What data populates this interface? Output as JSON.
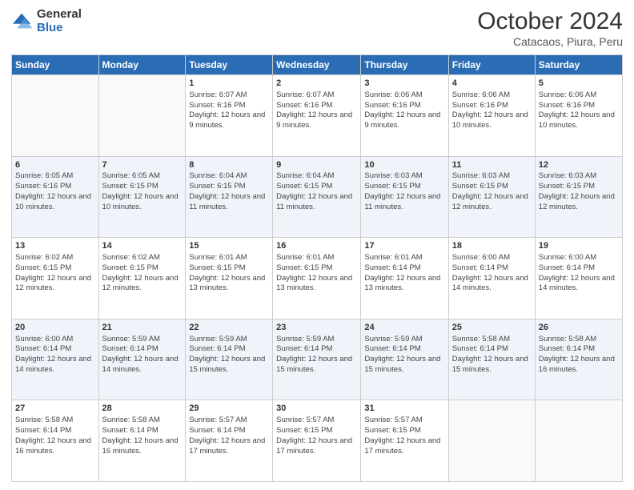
{
  "logo": {
    "general": "General",
    "blue": "Blue"
  },
  "header": {
    "month": "October 2024",
    "location": "Catacaos, Piura, Peru"
  },
  "weekdays": [
    "Sunday",
    "Monday",
    "Tuesday",
    "Wednesday",
    "Thursday",
    "Friday",
    "Saturday"
  ],
  "weeks": [
    [
      {
        "day": "",
        "empty": true
      },
      {
        "day": "",
        "empty": true
      },
      {
        "day": "1",
        "sunrise": "6:07 AM",
        "sunset": "6:16 PM",
        "daylight": "12 hours and 9 minutes."
      },
      {
        "day": "2",
        "sunrise": "6:07 AM",
        "sunset": "6:16 PM",
        "daylight": "12 hours and 9 minutes."
      },
      {
        "day": "3",
        "sunrise": "6:06 AM",
        "sunset": "6:16 PM",
        "daylight": "12 hours and 9 minutes."
      },
      {
        "day": "4",
        "sunrise": "6:06 AM",
        "sunset": "6:16 PM",
        "daylight": "12 hours and 10 minutes."
      },
      {
        "day": "5",
        "sunrise": "6:06 AM",
        "sunset": "6:16 PM",
        "daylight": "12 hours and 10 minutes."
      }
    ],
    [
      {
        "day": "6",
        "sunrise": "6:05 AM",
        "sunset": "6:16 PM",
        "daylight": "12 hours and 10 minutes."
      },
      {
        "day": "7",
        "sunrise": "6:05 AM",
        "sunset": "6:15 PM",
        "daylight": "12 hours and 10 minutes."
      },
      {
        "day": "8",
        "sunrise": "6:04 AM",
        "sunset": "6:15 PM",
        "daylight": "12 hours and 11 minutes."
      },
      {
        "day": "9",
        "sunrise": "6:04 AM",
        "sunset": "6:15 PM",
        "daylight": "12 hours and 11 minutes."
      },
      {
        "day": "10",
        "sunrise": "6:03 AM",
        "sunset": "6:15 PM",
        "daylight": "12 hours and 11 minutes."
      },
      {
        "day": "11",
        "sunrise": "6:03 AM",
        "sunset": "6:15 PM",
        "daylight": "12 hours and 12 minutes."
      },
      {
        "day": "12",
        "sunrise": "6:03 AM",
        "sunset": "6:15 PM",
        "daylight": "12 hours and 12 minutes."
      }
    ],
    [
      {
        "day": "13",
        "sunrise": "6:02 AM",
        "sunset": "6:15 PM",
        "daylight": "12 hours and 12 minutes."
      },
      {
        "day": "14",
        "sunrise": "6:02 AM",
        "sunset": "6:15 PM",
        "daylight": "12 hours and 12 minutes."
      },
      {
        "day": "15",
        "sunrise": "6:01 AM",
        "sunset": "6:15 PM",
        "daylight": "12 hours and 13 minutes."
      },
      {
        "day": "16",
        "sunrise": "6:01 AM",
        "sunset": "6:15 PM",
        "daylight": "12 hours and 13 minutes."
      },
      {
        "day": "17",
        "sunrise": "6:01 AM",
        "sunset": "6:14 PM",
        "daylight": "12 hours and 13 minutes."
      },
      {
        "day": "18",
        "sunrise": "6:00 AM",
        "sunset": "6:14 PM",
        "daylight": "12 hours and 14 minutes."
      },
      {
        "day": "19",
        "sunrise": "6:00 AM",
        "sunset": "6:14 PM",
        "daylight": "12 hours and 14 minutes."
      }
    ],
    [
      {
        "day": "20",
        "sunrise": "6:00 AM",
        "sunset": "6:14 PM",
        "daylight": "12 hours and 14 minutes."
      },
      {
        "day": "21",
        "sunrise": "5:59 AM",
        "sunset": "6:14 PM",
        "daylight": "12 hours and 14 minutes."
      },
      {
        "day": "22",
        "sunrise": "5:59 AM",
        "sunset": "6:14 PM",
        "daylight": "12 hours and 15 minutes."
      },
      {
        "day": "23",
        "sunrise": "5:59 AM",
        "sunset": "6:14 PM",
        "daylight": "12 hours and 15 minutes."
      },
      {
        "day": "24",
        "sunrise": "5:59 AM",
        "sunset": "6:14 PM",
        "daylight": "12 hours and 15 minutes."
      },
      {
        "day": "25",
        "sunrise": "5:58 AM",
        "sunset": "6:14 PM",
        "daylight": "12 hours and 15 minutes."
      },
      {
        "day": "26",
        "sunrise": "5:58 AM",
        "sunset": "6:14 PM",
        "daylight": "12 hours and 16 minutes."
      }
    ],
    [
      {
        "day": "27",
        "sunrise": "5:58 AM",
        "sunset": "6:14 PM",
        "daylight": "12 hours and 16 minutes."
      },
      {
        "day": "28",
        "sunrise": "5:58 AM",
        "sunset": "6:14 PM",
        "daylight": "12 hours and 16 minutes."
      },
      {
        "day": "29",
        "sunrise": "5:57 AM",
        "sunset": "6:14 PM",
        "daylight": "12 hours and 17 minutes."
      },
      {
        "day": "30",
        "sunrise": "5:57 AM",
        "sunset": "6:15 PM",
        "daylight": "12 hours and 17 minutes."
      },
      {
        "day": "31",
        "sunrise": "5:57 AM",
        "sunset": "6:15 PM",
        "daylight": "12 hours and 17 minutes."
      },
      {
        "day": "",
        "empty": true
      },
      {
        "day": "",
        "empty": true
      }
    ]
  ]
}
